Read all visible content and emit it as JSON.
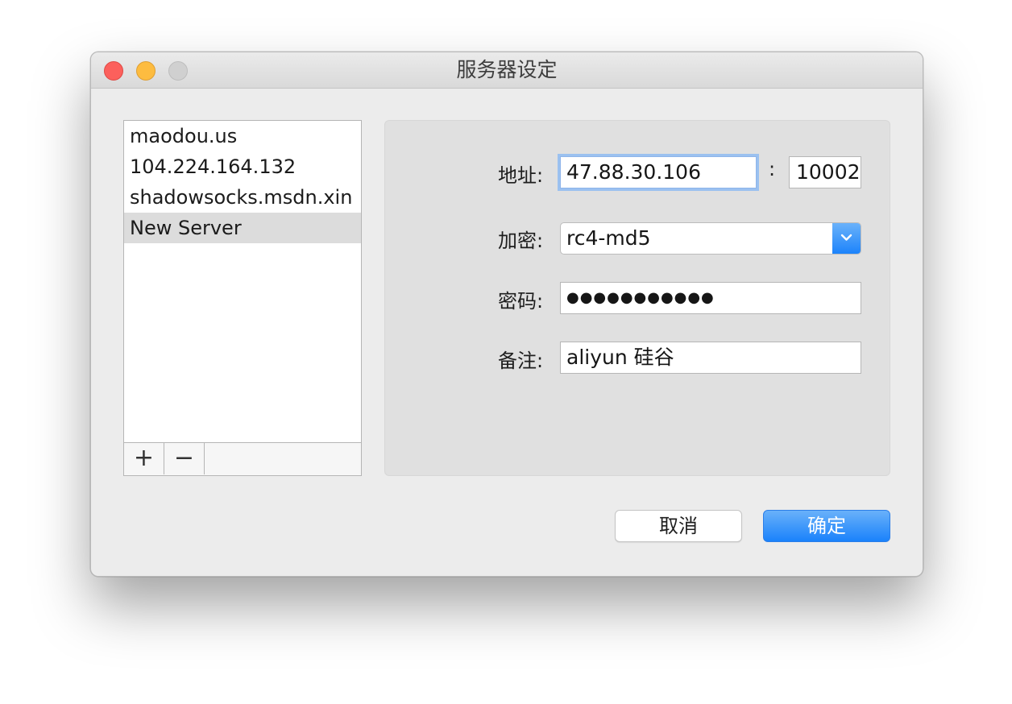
{
  "window": {
    "title": "服务器设定"
  },
  "server_list": {
    "items": [
      "maodou.us",
      "104.224.164.132",
      "shadowsocks.msdn.xin",
      "New Server"
    ],
    "selected_index": 3,
    "add_label": "+",
    "remove_label": "−"
  },
  "form": {
    "address_label": "地址:",
    "address_value": "47.88.30.106",
    "port_separator": ":",
    "port_value": "10002",
    "encryption_label": "加密:",
    "encryption_value": "rc4-md5",
    "password_label": "密码:",
    "password_value": "●●●●●●●●●●●",
    "remark_label": "备注:",
    "remark_value": "aliyun 硅谷"
  },
  "buttons": {
    "cancel": "取消",
    "ok": "确定"
  },
  "colors": {
    "accent": "#1a82fb",
    "close": "#fc605c",
    "minimize": "#fdbc40",
    "zoom_disabled": "#d0d0d0"
  }
}
